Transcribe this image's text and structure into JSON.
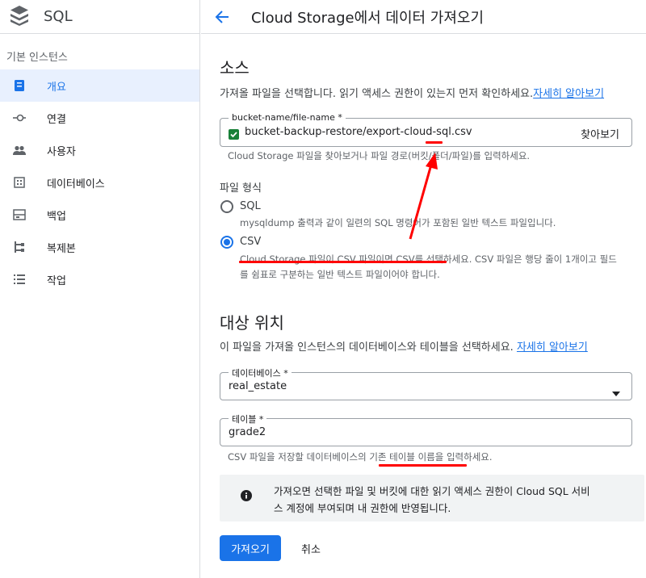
{
  "app": {
    "name": "SQL"
  },
  "sidebar": {
    "section_label": "기본 인스턴스",
    "items": [
      {
        "label": "개요",
        "icon": "overview-icon",
        "active": true
      },
      {
        "label": "연결",
        "icon": "connections-icon"
      },
      {
        "label": "사용자",
        "icon": "users-icon"
      },
      {
        "label": "데이터베이스",
        "icon": "databases-icon"
      },
      {
        "label": "백업",
        "icon": "backups-icon"
      },
      {
        "label": "복제본",
        "icon": "replicas-icon"
      },
      {
        "label": "작업",
        "icon": "operations-icon"
      }
    ]
  },
  "header": {
    "title": "Cloud Storage에서 데이터 가져오기"
  },
  "source": {
    "heading": "소스",
    "description": "가져올 파일을 선택합니다. 읽기 액세스 권한이 있는지 먼저 확인하세요.",
    "learn_more": "자세히 알아보기",
    "path_label": "bucket-name/file-name *",
    "path_value": "bucket-backup-restore/export-cloud-sql.csv",
    "browse": "찾아보기",
    "path_hint": "Cloud Storage 파일을 찾아보거나 파일 경로(버킷/폴더/파일)를 입력하세요."
  },
  "format": {
    "label": "파일 형식",
    "options": [
      {
        "label": "SQL",
        "desc": "mysqldump 출력과 같이 일련의 SQL 명령어가 포함된 일반 텍스트 파일입니다.",
        "checked": false
      },
      {
        "label": "CSV",
        "desc_line1": "Cloud Storage 파일이 CSV 파일이면 CSV를 선택하세요. CSV 파일은 행당 줄이 1개이고 필드",
        "desc_line2": "를 쉼표로 구분하는 일반 텍스트 파일이어야 합니다.",
        "checked": true
      }
    ]
  },
  "destination": {
    "heading": "대상 위치",
    "description": "이 파일을 가져올 인스턴스의 데이터베이스와 테이블을 선택하세요.",
    "learn_more": "자세히 알아보기",
    "database_label": "데이터베이스 *",
    "database_value": "real_estate",
    "table_label": "테이블 *",
    "table_value": "grade2",
    "table_hint": "CSV 파일을 저장할 데이터베이스의 기존 테이블 이름을 입력하세요."
  },
  "notice": {
    "line1": "가져오면 선택한 파일 및 버킷에 대한 읽기 액세스 권한이 Cloud SQL 서비",
    "line2": "스 계정에 부여되며 내 권한에 반영됩니다."
  },
  "actions": {
    "import": "가져오기",
    "cancel": "취소"
  },
  "colors": {
    "accent": "#1a73e8",
    "annotation": "#ff0000",
    "checkbox": "#188038"
  }
}
